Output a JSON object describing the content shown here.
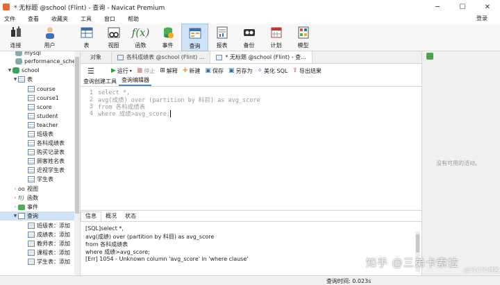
{
  "window": {
    "title": "* 无标题 @school (Flint) - 查询 - Navicat Premium"
  },
  "menu": {
    "items": [
      "文件",
      "查看",
      "收藏夹",
      "工具",
      "窗口",
      "帮助"
    ],
    "login": "登录"
  },
  "toolbar": {
    "buttons": [
      {
        "label": "连接",
        "icon": "plug-icon"
      },
      {
        "label": "用户",
        "icon": "user-icon"
      },
      {
        "label": "表",
        "icon": "table-icon"
      },
      {
        "label": "视图",
        "icon": "view-icon"
      },
      {
        "label": "函数",
        "icon": "function-icon"
      },
      {
        "label": "事件",
        "icon": "event-icon"
      },
      {
        "label": "查询",
        "icon": "query-icon"
      },
      {
        "label": "报表",
        "icon": "report-icon"
      },
      {
        "label": "备份",
        "icon": "backup-icon"
      },
      {
        "label": "计划",
        "icon": "calendar-icon"
      },
      {
        "label": "模型",
        "icon": "model-icon"
      }
    ],
    "active": "查询"
  },
  "sidebar": {
    "top_items": [
      "mysql",
      "performance_schema",
      "school"
    ],
    "tables_node": "表",
    "tables": [
      "course",
      "course1",
      "score",
      "student",
      "teacher",
      "班级表",
      "各科成绩表",
      "购买记录表",
      "顾客姓名表",
      "近视学生表",
      "学生表"
    ],
    "other_nodes": [
      "视图",
      "函数",
      "事件",
      "查询"
    ],
    "queries": [
      "班级表：添加",
      "成绩表：添加",
      "教师表：添加",
      "课程表：添加",
      "学生表：添加"
    ]
  },
  "tabs": [
    {
      "label": "对象",
      "active": false
    },
    {
      "label": "各科成绩表 @school (Flint) ...",
      "active": false
    },
    {
      "label": "* 无标题 @school (Flint) - 查...",
      "active": true
    }
  ],
  "query_toolbar": {
    "run": "运行",
    "stop": "停止",
    "explain": "解释",
    "new": "新建",
    "save": "保存",
    "save_as": "另存为",
    "beautify": "美化 SQL",
    "export": "导出结果"
  },
  "subtabs": [
    "查询创建工具",
    "查询编辑器"
  ],
  "editor": {
    "lines": [
      {
        "no": "1",
        "text": "select *,"
      },
      {
        "no": "2",
        "text": "avg(成绩) over (partition by 科目) as avg_score"
      },
      {
        "no": "3",
        "text": "from 各科成绩表"
      },
      {
        "no": "4",
        "text": "where 成绩>avg_score;"
      }
    ]
  },
  "result": {
    "tabs": [
      "信息",
      "概况",
      "状态"
    ],
    "messages": [
      "[SQL]select *,",
      "avg(成绩) over (partition by 科目) as avg_score",
      "from 各科成绩表",
      "where 成绩>avg_score;",
      "[Err] 1054 - Unknown column 'avg_score' in 'where clause'"
    ]
  },
  "right_panel": {
    "empty_text": "没有可用的活动。"
  },
  "status": {
    "query_time": "查询时间: 0.023s"
  },
  "watermark": {
    "text": "知乎 @三弟卡索拉",
    "sub": "@51CTO博客"
  }
}
